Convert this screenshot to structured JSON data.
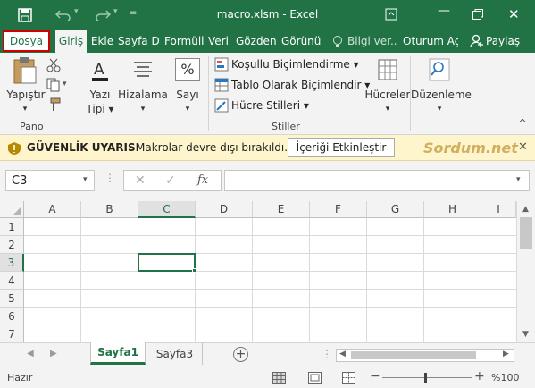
{
  "window": {
    "title": "macro.xlsm - Excel",
    "controls": [
      "save-icon",
      "undo-icon",
      "redo-icon",
      "customize-icon",
      "ribbon-display-icon",
      "minimize-icon",
      "restore-icon",
      "close-icon"
    ]
  },
  "tabs": [
    {
      "label": "Dosya"
    },
    {
      "label": "Giriş"
    },
    {
      "label": "Ekle"
    },
    {
      "label": "Sayfa Dü"
    },
    {
      "label": "Formüll"
    },
    {
      "label": "Veri"
    },
    {
      "label": "Gözden"
    },
    {
      "label": "Görünü"
    },
    {
      "label": "Bilgi ver.."
    },
    {
      "label": "Oturum Aç"
    },
    {
      "label": "Paylaş"
    }
  ],
  "ribbon": {
    "paste": {
      "line1": "Yapıştır",
      "arrow": "▾"
    },
    "font": {
      "line1": "Yazı",
      "line2": "Tipi ▾"
    },
    "alignment": {
      "line1": "Hizalama",
      "arrow": "▾"
    },
    "number": {
      "line1": "Sayı",
      "arrow": "▾",
      "glyph": "%"
    },
    "styles": [
      {
        "label": "Koşullu Biçimlendirme ▾"
      },
      {
        "label": "Tablo Olarak Biçimlendir ▾"
      },
      {
        "label": "Hücre Stilleri ▾"
      }
    ],
    "cells": {
      "line1": "Hücreler",
      "arrow": "▾"
    },
    "editing": {
      "line1": "Düzenleme",
      "arrow": "▾"
    },
    "group_labels": {
      "clipboard": "Pano",
      "styles": "Stiller"
    }
  },
  "message_bar": {
    "title": "GÜVENLİK UYARISI",
    "text": "Makrolar devre dışı bırakıldı.",
    "button": "İçeriği Etkinleştir",
    "watermark": "Sordum.net"
  },
  "formula_bar": {
    "name_box": "C3",
    "fx": "fx",
    "value": ""
  },
  "grid": {
    "columns": [
      "A",
      "B",
      "C",
      "D",
      "E",
      "F",
      "G",
      "H",
      "I"
    ],
    "rows": [
      "1",
      "2",
      "3",
      "4",
      "5",
      "6",
      "7"
    ],
    "active_cell": "C3"
  },
  "sheets": {
    "tabs": [
      {
        "label": "Sayfa1",
        "active": true
      },
      {
        "label": "Sayfa3",
        "active": false
      }
    ],
    "add": "+"
  },
  "status": {
    "text": "Hazır",
    "zoom": "%100"
  },
  "colors": {
    "brand": "#217346",
    "highlight": "#d00000",
    "message_bg": "#fff5cc"
  }
}
